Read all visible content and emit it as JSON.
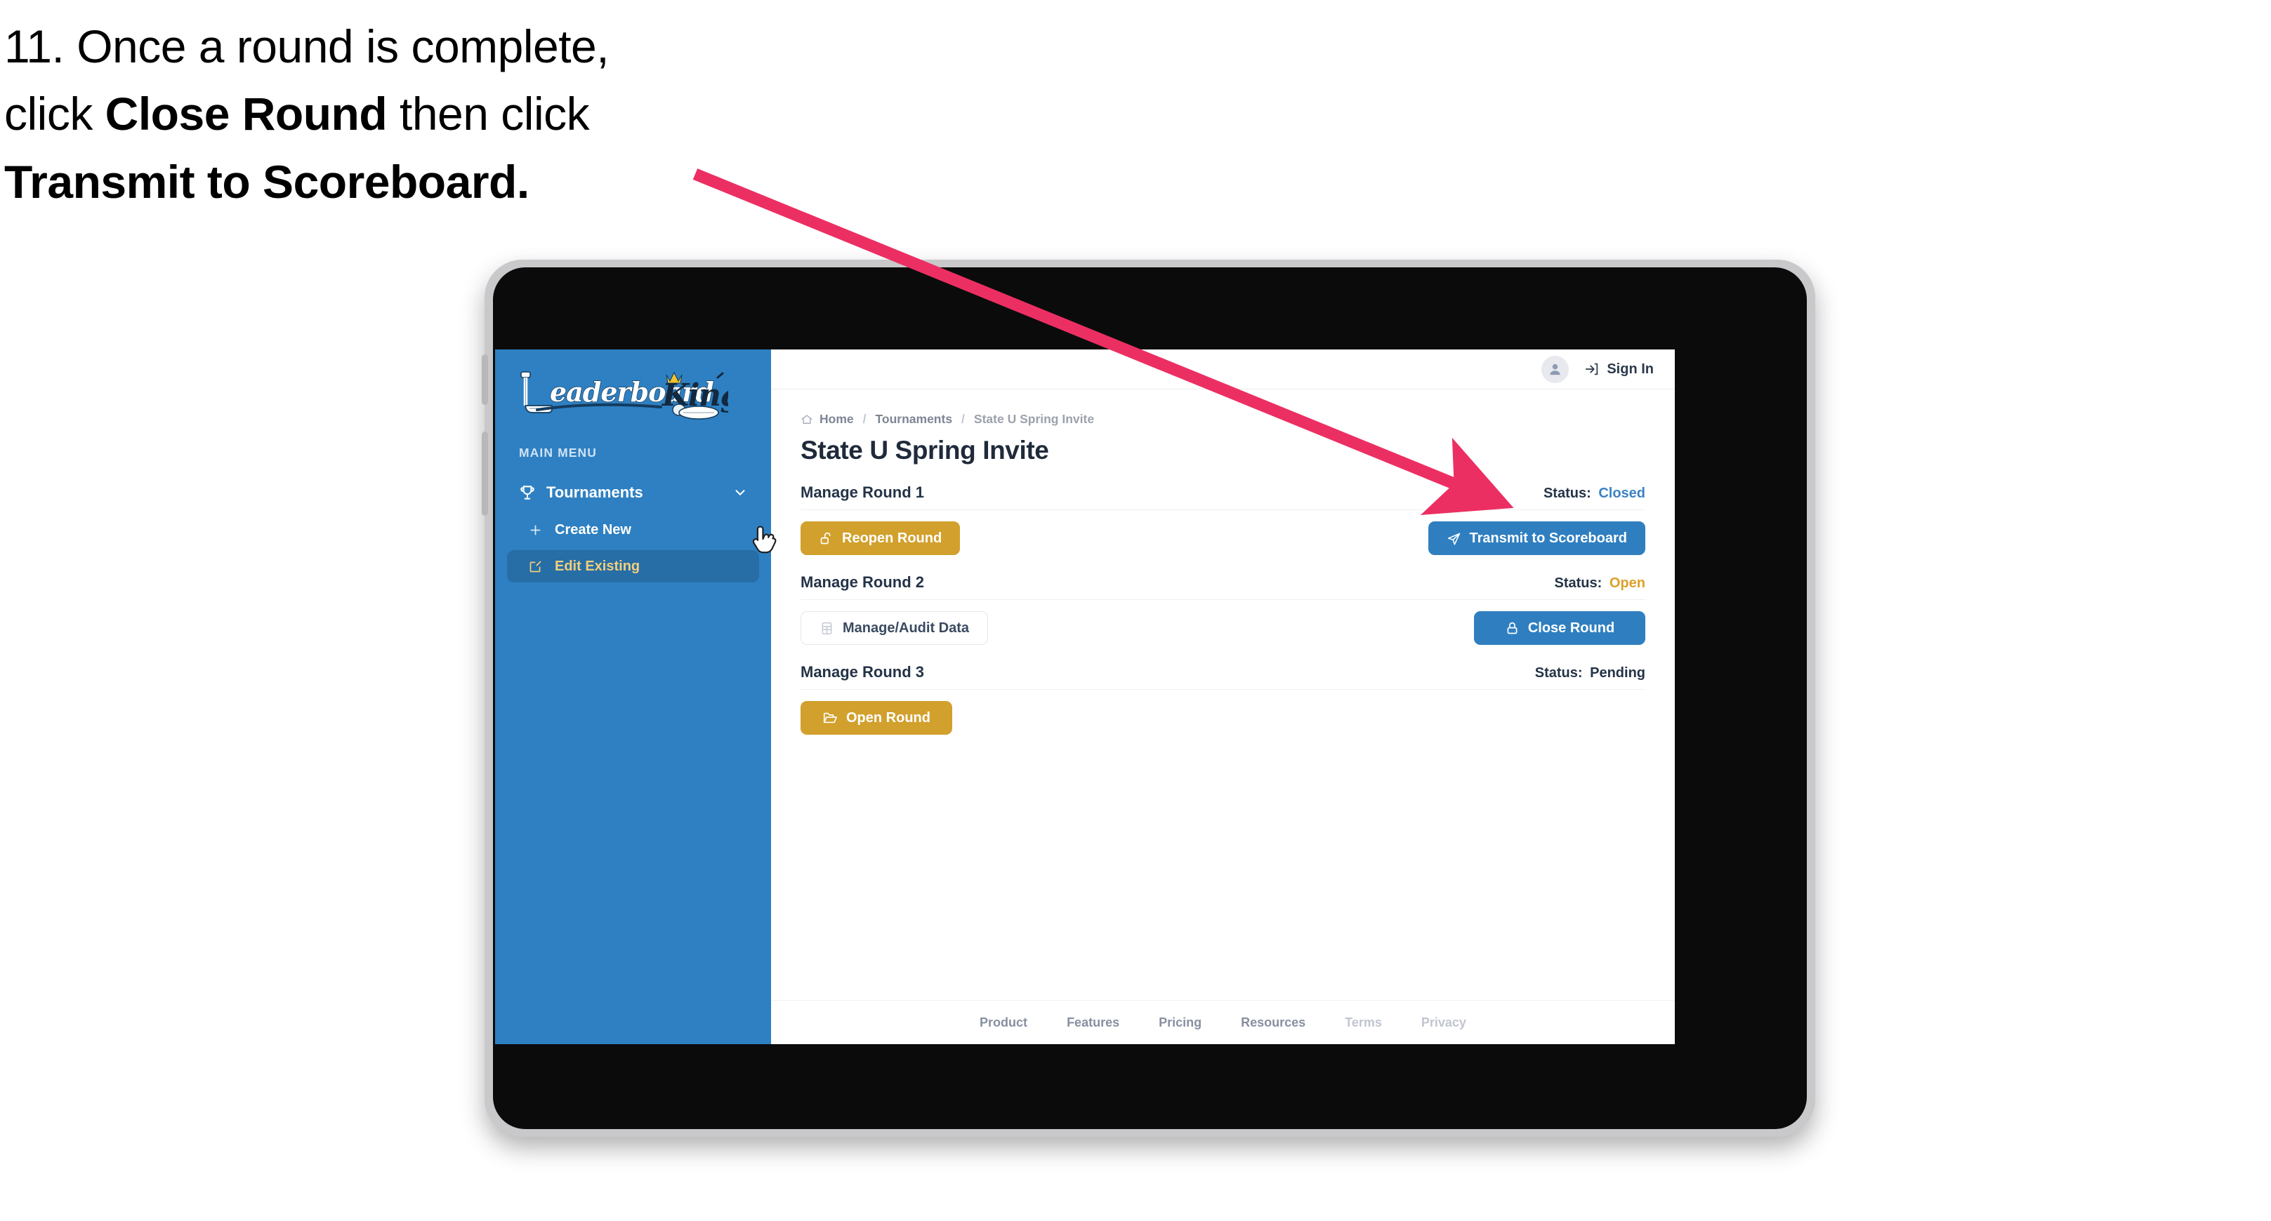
{
  "instruction": {
    "number": "11.",
    "line1_pre": "11. Once a round is complete,",
    "line2_pre": "click ",
    "line2_bold": "Close Round",
    "line2_post": " then click",
    "line3_bold": "Transmit to Scoreboard.",
    "arrow_color": "#ec2f63"
  },
  "sidebar": {
    "logo_primary": "Leaderboard",
    "logo_secondary": "King",
    "section_label": "MAIN MENU",
    "nav": [
      {
        "label": "Tournaments",
        "icon": "trophy-icon",
        "chevron": "chevron-down-icon",
        "expanded": true
      }
    ],
    "sub_items": [
      {
        "label": "Create New",
        "icon": "plus-icon",
        "active": false
      },
      {
        "label": "Edit Existing",
        "icon": "edit-pencil-icon",
        "active": true
      }
    ],
    "bg_color": "#2e80c2",
    "active_bg_color": "#276da6",
    "active_text_color": "#f0cf7d"
  },
  "topbar": {
    "avatar_icon": "user-avatar-icon",
    "signin_icon": "login-arrow-icon",
    "signin_label": "Sign In"
  },
  "breadcrumb": {
    "home_icon": "home-icon",
    "items": [
      "Home",
      "Tournaments",
      "State U Spring Invite"
    ],
    "separator": "/"
  },
  "page": {
    "title": "State U Spring Invite"
  },
  "rounds": [
    {
      "title": "Manage Round 1",
      "status_label": "Status:",
      "status_value": "Closed",
      "status_class": "status-closed",
      "left_button": {
        "label": "Reopen Round",
        "icon": "unlock-icon",
        "style": "btn-gold"
      },
      "right_button": {
        "label": "Transmit to Scoreboard",
        "icon": "paper-plane-icon",
        "style": "btn-blue"
      }
    },
    {
      "title": "Manage Round 2",
      "status_label": "Status:",
      "status_value": "Open",
      "status_class": "status-open",
      "left_button": {
        "label": "Manage/Audit Data",
        "icon": "table-grid-icon",
        "style": "btn-ghost"
      },
      "right_button": {
        "label": "Close Round",
        "icon": "lock-closed-icon",
        "style": "btn-blue"
      }
    },
    {
      "title": "Manage Round 3",
      "status_label": "Status:",
      "status_value": "Pending",
      "status_class": "status-pending",
      "left_button": {
        "label": "Open Round",
        "icon": "open-folder-icon",
        "style": "btn-gold"
      },
      "right_button": null
    }
  ],
  "footer": {
    "links": [
      "Product",
      "Features",
      "Pricing",
      "Resources"
    ],
    "muted_links": [
      "Terms",
      "Privacy"
    ]
  },
  "colors": {
    "gold": "#d2a02c",
    "blue": "#2f7fc0",
    "sidebar_blue": "#2e80c2",
    "status_closed": "#3b82c4",
    "status_open": "#dda02a",
    "arrow_pink": "#ec2f63"
  },
  "cursor": {
    "type": "pointing-hand"
  }
}
